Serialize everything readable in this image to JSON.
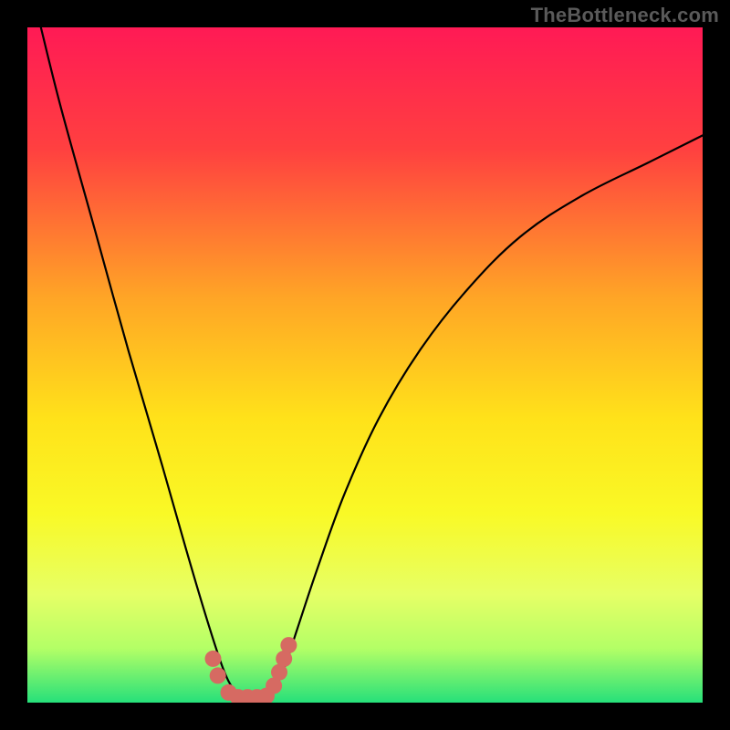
{
  "watermark": "TheBottleneck.com",
  "chart_data": {
    "type": "line",
    "title": "",
    "xlabel": "",
    "ylabel": "",
    "xlim": [
      0,
      100
    ],
    "ylim": [
      0,
      100
    ],
    "series": [
      {
        "name": "bottleneck-curve",
        "x": [
          2,
          5,
          10,
          15,
          20,
          24,
          27,
          29,
          30.5,
          32,
          33.5,
          35,
          36.5,
          38,
          40,
          43,
          47,
          52,
          58,
          65,
          73,
          82,
          92,
          100
        ],
        "y": [
          100,
          88,
          70,
          52,
          35,
          21,
          11,
          5,
          2,
          0.5,
          0.5,
          0.5,
          2,
          5,
          11,
          20,
          31,
          42,
          52,
          61,
          69,
          75,
          80,
          84
        ]
      }
    ],
    "bottom_zone_markers": {
      "name": "low-bottleneck-markers",
      "x": [
        27.5,
        28.2,
        29.8,
        31.2,
        32.6,
        34.0,
        35.4,
        36.5,
        37.3,
        38.0,
        38.7
      ],
      "y": [
        6.5,
        4.0,
        1.5,
        0.8,
        0.8,
        0.8,
        1.0,
        2.5,
        4.5,
        6.5,
        8.5
      ]
    },
    "gradient_stops": [
      {
        "offset": 0,
        "color": "#ff1a55"
      },
      {
        "offset": 18,
        "color": "#ff4040"
      },
      {
        "offset": 40,
        "color": "#ffa526"
      },
      {
        "offset": 58,
        "color": "#ffe21a"
      },
      {
        "offset": 72,
        "color": "#f9f926"
      },
      {
        "offset": 84,
        "color": "#e6ff66"
      },
      {
        "offset": 92,
        "color": "#b3ff66"
      },
      {
        "offset": 100,
        "color": "#26e07a"
      }
    ]
  }
}
